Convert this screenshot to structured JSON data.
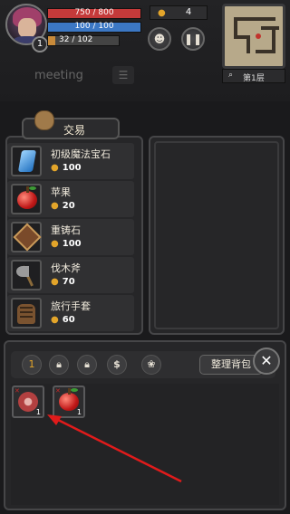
{
  "hud": {
    "level": "1",
    "hp": "750 / 800",
    "mp": "100 / 100",
    "xp": "32 / 102",
    "gold": "4",
    "floor": "第1层",
    "chat_placeholder": "meeting"
  },
  "trade": {
    "title": "交易",
    "items": [
      {
        "name": "初级魔法宝石",
        "price": "100",
        "icon": "blue-gem-icon"
      },
      {
        "name": "苹果",
        "price": "20",
        "icon": "apple-icon"
      },
      {
        "name": "重铸石",
        "price": "100",
        "icon": "reforge-stone-icon"
      },
      {
        "name": "伐木斧",
        "price": "70",
        "icon": "axe-icon"
      },
      {
        "name": "旅行手套",
        "price": "60",
        "icon": "glove-icon"
      }
    ]
  },
  "inventory": {
    "toolbar_number": "1",
    "sort_label": "整理背包",
    "close_label": "✕",
    "slots": [
      {
        "icon": "meat-icon",
        "count": "1"
      },
      {
        "icon": "apple-icon",
        "count": "1"
      }
    ]
  },
  "colors": {
    "hp_bar": "#c53a3a",
    "mp_bar": "#3c78c4",
    "xp_bar": "#c88a3a",
    "gold": "#e3a52a",
    "annotation_arrow": "#e01b1b"
  }
}
